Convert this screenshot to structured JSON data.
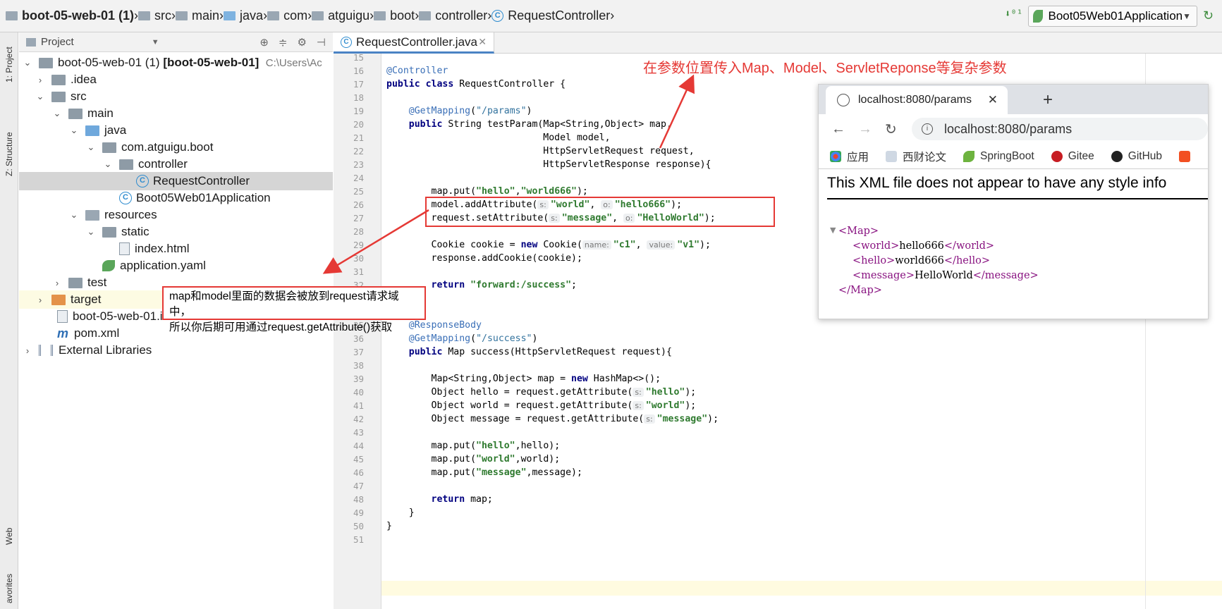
{
  "breadcrumb": {
    "items": [
      "boot-05-web-01 (1)",
      "src",
      "main",
      "java",
      "com",
      "atguigu",
      "boot",
      "controller",
      "RequestController"
    ]
  },
  "run_config": {
    "label": "Boot05Web01Application"
  },
  "side_tabs": {
    "project": "1: Project",
    "structure": "Z: Structure",
    "web": "Web",
    "favorites": "avorites"
  },
  "project_panel": {
    "title": "Project",
    "tree": [
      {
        "label": "boot-05-web-01 (1)",
        "bold": "[boot-05-web-01]",
        "path": "C:\\Users\\Ac"
      },
      {
        "label": ".idea"
      },
      {
        "label": "src"
      },
      {
        "label": "main"
      },
      {
        "label": "java"
      },
      {
        "label": "com.atguigu.boot"
      },
      {
        "label": "controller"
      },
      {
        "label": "RequestController"
      },
      {
        "label": "Boot05Web01Application"
      },
      {
        "label": "resources"
      },
      {
        "label": "static"
      },
      {
        "label": "index.html"
      },
      {
        "label": "application.yaml"
      },
      {
        "label": "test"
      },
      {
        "label": "target"
      },
      {
        "label": "boot-05-web-01.iml"
      },
      {
        "label": "pom.xml"
      },
      {
        "label": "External Libraries"
      }
    ]
  },
  "editor": {
    "tab": "RequestController.java",
    "line_numbers": [
      "15",
      "16",
      "17",
      "18",
      "19",
      "20",
      "21",
      "22",
      "23",
      "24",
      "25",
      "26",
      "27",
      "28",
      "29",
      "30",
      "31",
      "32",
      "33",
      "34",
      "35",
      "36",
      "37",
      "38",
      "39",
      "40",
      "41",
      "42",
      "43",
      "44",
      "45",
      "46",
      "47",
      "48",
      "49",
      "50",
      "51"
    ]
  },
  "annotations": {
    "top_note": "在参数位置传入Map、Model、ServletReponse等复杂参数",
    "box_note_line1": "map和model里面的数据会被放到request请求域中，",
    "box_note_line2": "所以你后期可用通过request.getAttribute()获取"
  },
  "browser": {
    "tab_title": "localhost:8080/params",
    "url": "localhost:8080/params",
    "bookmarks": [
      "应用",
      "西财论文",
      "SpringBoot",
      "Gitee",
      "GitHub"
    ],
    "xml_message": "This XML file does not appear to have any style info",
    "xml": {
      "root_open": "<Map>",
      "world_open": "<world>",
      "world_value": "hello666",
      "world_close": "</world>",
      "hello_open": "<hello>",
      "hello_value": "world666",
      "hello_close": "</hello>",
      "message_open": "<message>",
      "message_value": "HelloWorld",
      "message_close": "</message>",
      "root_close": "</Map>"
    }
  },
  "colors": {
    "annotation_red": "#e53935",
    "keyword": "#000080",
    "string": "#2f7a2f",
    "annotation": "#3a6fb7",
    "xml_tag": "#881280"
  }
}
